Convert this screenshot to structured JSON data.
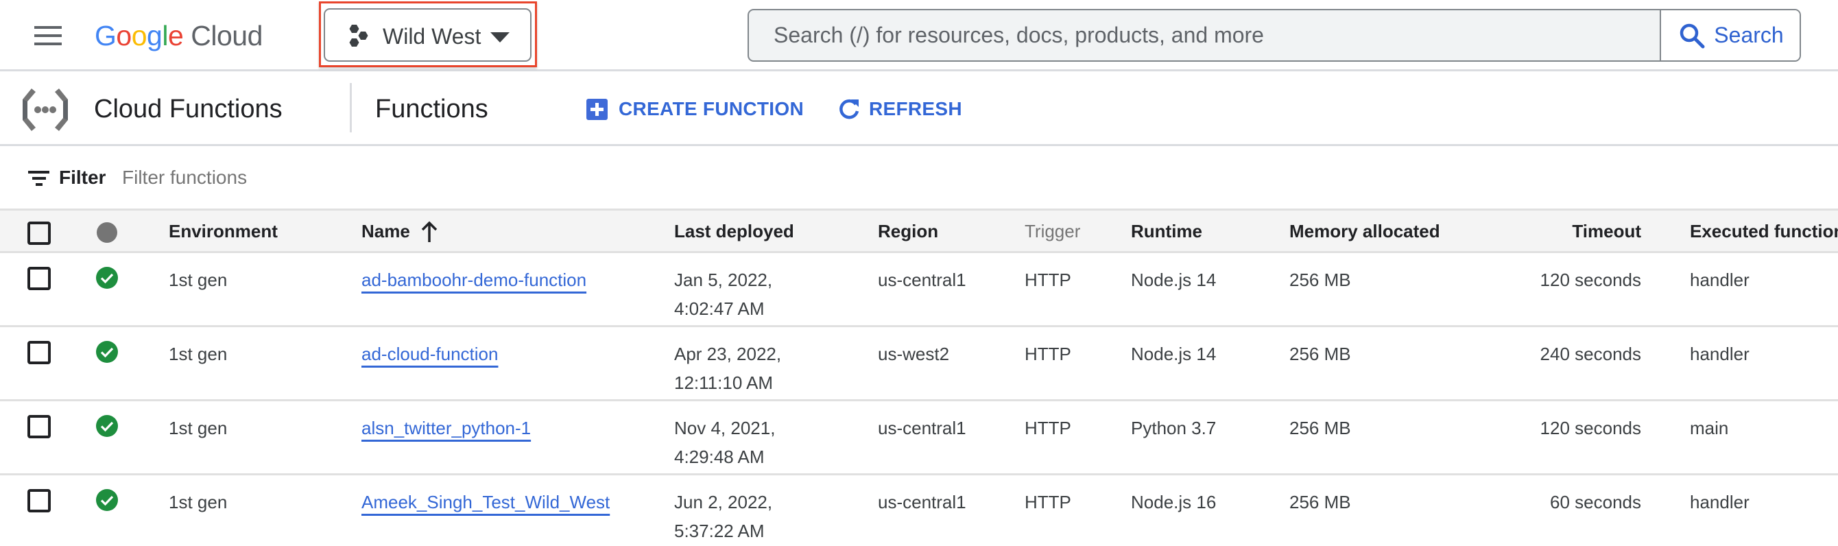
{
  "header": {
    "logo": {
      "google_letters": [
        "G",
        "o",
        "o",
        "g",
        "l",
        "e"
      ],
      "product": "Cloud"
    },
    "project_picker": {
      "selected": "Wild West",
      "highlight_color": "#e8452c"
    },
    "search": {
      "placeholder": "Search (/) for resources, docs, products, and more",
      "value": "",
      "button_label": "Search"
    }
  },
  "subbar": {
    "product_name": "Cloud Functions",
    "page_title": "Functions",
    "actions": {
      "create_label": "CREATE FUNCTION",
      "refresh_label": "REFRESH"
    }
  },
  "filter": {
    "label": "Filter",
    "placeholder": "Filter functions",
    "value": ""
  },
  "table": {
    "columns": {
      "environment": "Environment",
      "name": "Name",
      "last_deployed": "Last deployed",
      "region": "Region",
      "trigger": "Trigger",
      "runtime": "Runtime",
      "memory": "Memory allocated",
      "timeout": "Timeout",
      "executed_function": "Executed function"
    },
    "sort": {
      "column": "Name",
      "direction": "ascending"
    },
    "rows": [
      {
        "status": "ok",
        "environment": "1st gen",
        "name": "ad-bamboohr-demo-function",
        "last_deployed_date": "Jan 5, 2022,",
        "last_deployed_time": "4:02:47 AM",
        "region": "us-central1",
        "trigger": "HTTP",
        "runtime": "Node.js 14",
        "memory": "256 MB",
        "timeout": "120 seconds",
        "executed_function": "handler"
      },
      {
        "status": "ok",
        "environment": "1st gen",
        "name": "ad-cloud-function",
        "last_deployed_date": "Apr 23, 2022,",
        "last_deployed_time": "12:11:10 AM",
        "region": "us-west2",
        "trigger": "HTTP",
        "runtime": "Node.js 14",
        "memory": "256 MB",
        "timeout": "240 seconds",
        "executed_function": "handler"
      },
      {
        "status": "ok",
        "environment": "1st gen",
        "name": "alsn_twitter_python-1",
        "last_deployed_date": "Nov 4, 2021,",
        "last_deployed_time": "4:29:48 AM",
        "region": "us-central1",
        "trigger": "HTTP",
        "runtime": "Python 3.7",
        "memory": "256 MB",
        "timeout": "120 seconds",
        "executed_function": "main"
      },
      {
        "status": "ok",
        "environment": "1st gen",
        "name": "Ameek_Singh_Test_Wild_West",
        "last_deployed_date": "Jun 2, 2022,",
        "last_deployed_time": "5:37:22 AM",
        "region": "us-central1",
        "trigger": "HTTP",
        "runtime": "Node.js 16",
        "memory": "256 MB",
        "timeout": "60 seconds",
        "executed_function": "handler"
      }
    ]
  },
  "colors": {
    "accent_blue": "#3367d6",
    "status_ok": "#1e8e3e",
    "google_blue": "#4285f4",
    "google_red": "#ea4335",
    "google_yellow": "#fbbc04",
    "google_green": "#34a853"
  }
}
